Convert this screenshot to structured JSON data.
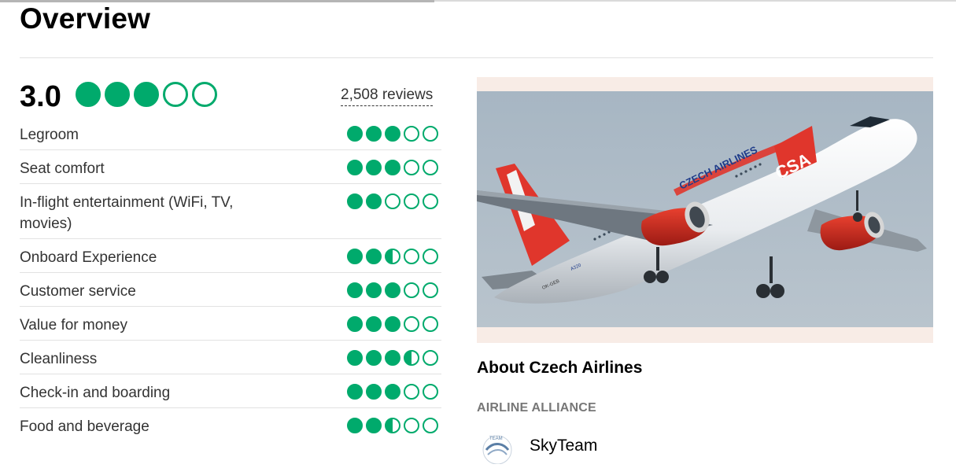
{
  "page": {
    "title": "Overview"
  },
  "overall": {
    "score": "3.0",
    "rating": 3.0,
    "max": 5,
    "reviews": "2,508 reviews"
  },
  "categories": [
    {
      "label": "Legroom",
      "rating": 3.0
    },
    {
      "label": "Seat comfort",
      "rating": 3.0
    },
    {
      "label": "In-flight entertainment (WiFi, TV, movies)",
      "rating": 2.0
    },
    {
      "label": "Onboard Experience",
      "rating": 2.5
    },
    {
      "label": "Customer service",
      "rating": 3.0
    },
    {
      "label": "Value for money",
      "rating": 3.0
    },
    {
      "label": "Cleanliness",
      "rating": 3.5
    },
    {
      "label": "Check-in and boarding",
      "rating": 3.0
    },
    {
      "label": "Food and beverage",
      "rating": 2.5
    }
  ],
  "photo": {
    "fuselage_text": "CZECH AIRLINES",
    "tail_text": "CSA",
    "registration": "OK-GEB",
    "model": "A320"
  },
  "about": {
    "heading": "About Czech Airlines",
    "alliance_heading": "AIRLINE ALLIANCE",
    "alliance_name": "SkyTeam",
    "alliance_logo_text": "TEAM"
  },
  "colors": {
    "bubble": "#00aa6c",
    "photo_frame": "#f8ece6",
    "divider": "#e2e2e2"
  }
}
